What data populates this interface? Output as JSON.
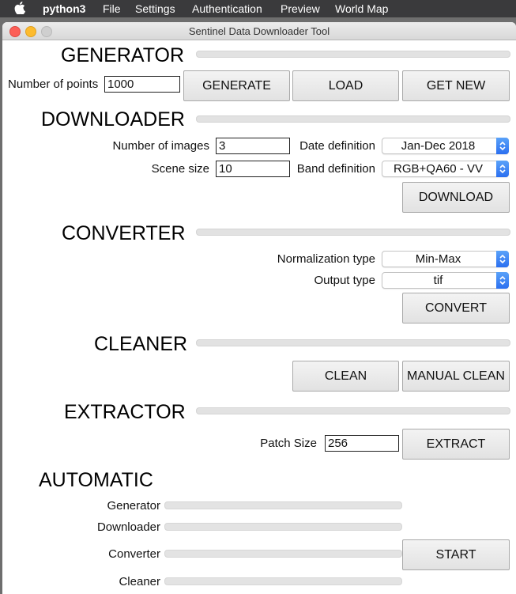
{
  "menubar": {
    "app": "python3",
    "items": [
      "File",
      "Settings",
      "Authentication",
      "Preview",
      "World Map"
    ]
  },
  "window": {
    "title": "Sentinel Data Downloader Tool"
  },
  "generator": {
    "title": "GENERATOR",
    "points_label": "Number of points",
    "points_value": "1000",
    "generate_button": "GENERATE",
    "load_button": "LOAD",
    "get_new_button": "GET NEW"
  },
  "downloader": {
    "title": "DOWNLOADER",
    "images_label": "Number of images",
    "images_value": "3",
    "scene_label": "Scene size",
    "scene_value": "10",
    "date_label": "Date definition",
    "date_value": "Jan-Dec 2018",
    "band_label": "Band definition",
    "band_value": "RGB+QA60 - VV",
    "download_button": "DOWNLOAD"
  },
  "converter": {
    "title": "CONVERTER",
    "norm_label": "Normalization type",
    "norm_value": "Min-Max",
    "output_label": "Output type",
    "output_value": "tif",
    "convert_button": "CONVERT"
  },
  "cleaner": {
    "title": "CLEANER",
    "clean_button": "CLEAN",
    "manual_button": "MANUAL CLEAN"
  },
  "extractor": {
    "title": "EXTRACTOR",
    "patch_label": "Patch Size",
    "patch_value": "256",
    "extract_button": "EXTRACT"
  },
  "automatic": {
    "title": "AUTOMATIC",
    "generator_label": "Generator",
    "downloader_label": "Downloader",
    "converter_label": "Converter",
    "cleaner_label": "Cleaner",
    "start_button": "START",
    "progress": {
      "generator": 0,
      "downloader": 0,
      "converter": 0,
      "cleaner": 0
    }
  },
  "colors": {
    "select_arrow": "#2b6ff0",
    "close": "#fc5f57",
    "minimize": "#fdbb2e"
  }
}
